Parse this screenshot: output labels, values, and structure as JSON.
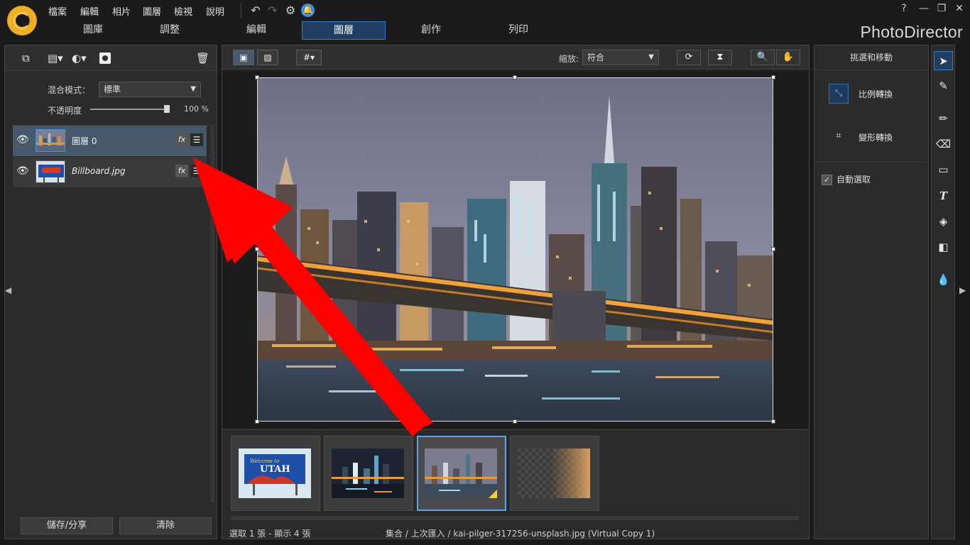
{
  "app": {
    "brand": "PhotoDirector"
  },
  "menu": [
    "檔案",
    "編輯",
    "相片",
    "圖層",
    "檢視",
    "說明"
  ],
  "tabs": [
    {
      "label": "圖庫"
    },
    {
      "label": "調整"
    },
    {
      "label": "編輯"
    },
    {
      "label": "圖層",
      "active": true
    },
    {
      "label": "創作"
    },
    {
      "label": "列印"
    }
  ],
  "left_panel": {
    "blend_label": "混合模式：",
    "blend_value": "標準",
    "opacity_label": "不透明度",
    "opacity_value": "100 %",
    "opacity_fraction": 1.0,
    "layers": [
      {
        "name": "圖層 0",
        "selected": true
      },
      {
        "name": "Billboard.jpg",
        "selected": false
      }
    ],
    "fx_label": "fx",
    "save_share": "儲存/分享",
    "clear": "清除"
  },
  "center": {
    "zoom_label": "縮放:",
    "zoom_value": "符合",
    "status_left": "選取 1 張 - 顯示 4 張",
    "status_path": "集合 / 上次匯入 / kai-pilger-317256-unsplash.jpg (Virtual Copy 1)",
    "billboard_text_small": "Welcome to",
    "billboard_text_big": "UTAH"
  },
  "right_panel": {
    "title": "挑選和移動",
    "items": [
      {
        "label": "比例轉換",
        "icon": "scale-transform-icon"
      },
      {
        "label": "變形轉換",
        "icon": "free-transform-icon"
      }
    ],
    "auto_select": "自動選取",
    "auto_select_checked": true
  },
  "tools": [
    "select-arrow-icon",
    "brush-select-icon",
    "pen-icon",
    "eraser-icon",
    "rectangle-icon",
    "text-icon",
    "fill-icon",
    "gradient-icon",
    "drop-icon"
  ],
  "colors": {
    "accent": "#3a79c1",
    "annotation_arrow": "#ff0000",
    "brand_logo": "#f0b429"
  }
}
